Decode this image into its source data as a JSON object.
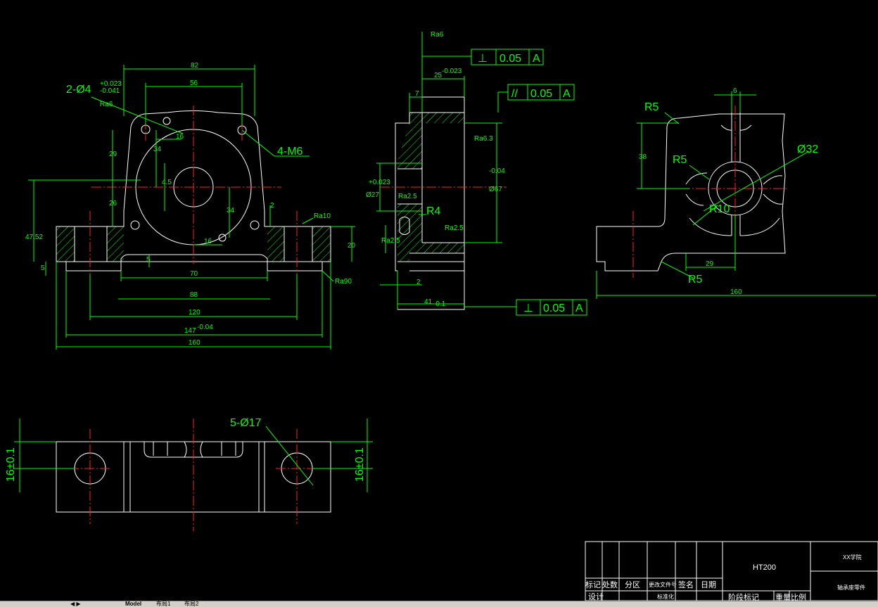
{
  "drawing": {
    "front_view": {
      "dims": {
        "overall_top": "82",
        "bolt_spacing": "56",
        "hole_callout": "2-Ø4",
        "tol_upper": "+0.023",
        "tol_lower": "-0.041",
        "rough_hole": "Ra6",
        "offset_16a": "16",
        "height_29": "29",
        "height_34a": "34",
        "height_45": "4.5",
        "thread": "4-M6",
        "height_26": "26",
        "height_34b": "34",
        "height_2": "2",
        "rough_top": "Ra10",
        "height_4752": "47.52",
        "offset_16b": "16",
        "height_20": "20",
        "height_5a": "5",
        "height_5b": "5",
        "width_70": "70",
        "width_88": "88",
        "width_120": "120",
        "width_147": "147",
        "tol_147": "-0.04",
        "width_160": "160",
        "rough_bottom": "Ra90"
      }
    },
    "side_view": {
      "dims": {
        "rough_top": "Ra6",
        "perp_symbol": "⊥",
        "perp_value": "0.05",
        "datum": "A",
        "width_25": "25",
        "tol_25": "-0.023",
        "width_7": "7",
        "parallel_symbol": "//",
        "parallel_value": "0.05",
        "rough_face": "Ra6.3",
        "dia_27": "Ø27",
        "tol_27": "+0.023",
        "dia_67": "Ø67",
        "tol_67": "-0.04",
        "rough_a": "Ra2.5",
        "radius_r4": "R4",
        "rough_b": "Ra2.5",
        "rough_c": "Ra2.5",
        "width_2": "2",
        "width_41": "41",
        "tol_41": "-0.1",
        "perp2_value": "0.05",
        "datum2": "A"
      }
    },
    "section_view": {
      "dims": {
        "width_6": "6",
        "radius_r5a": "R5",
        "dia_32": "Ø32",
        "height_38": "38",
        "radius_r5b": "R5",
        "radius_r10": "R10",
        "width_29": "29",
        "radius_r5c": "R5",
        "width_160": "160"
      }
    },
    "bottom_view": {
      "dims": {
        "holes": "5-Ø17",
        "left_tol": "16±0.1",
        "right_tol": "16±0.1"
      }
    },
    "title_block": {
      "material": "HT200",
      "school": "XX学院",
      "part_name": "轴承座零件",
      "col_mark": "标记",
      "col_count": "处数",
      "col_zone": "分区",
      "col_doc": "更改文件号",
      "col_sign": "签名",
      "col_date": "日期",
      "row_design": "设计",
      "row_std": "标准化",
      "stage_mark": "阶段标记",
      "weight": "重量",
      "scale": "比例"
    }
  },
  "tabs": {
    "model": "Model",
    "layout1": "布局1",
    "layout2": "布局2"
  },
  "colors": {
    "background": "#000000",
    "dimension": "#00ff00",
    "outline": "#ffffff",
    "centerline": "#ff2020"
  }
}
